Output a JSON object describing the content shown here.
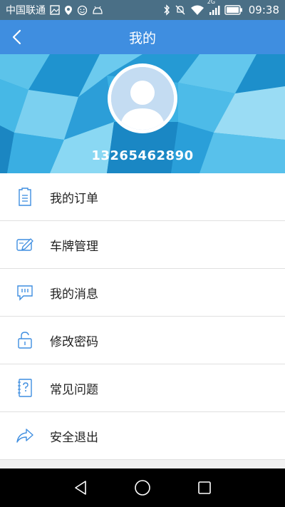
{
  "status_bar": {
    "carrier": "中国联通",
    "network": "2G",
    "time": "09:38"
  },
  "header": {
    "title": "我的"
  },
  "profile": {
    "phone": "13265462890"
  },
  "menu": {
    "items": [
      {
        "label": "我的订单",
        "icon": "order-list-icon"
      },
      {
        "label": "车牌管理",
        "icon": "license-plate-edit-icon"
      },
      {
        "label": "我的消息",
        "icon": "message-bubble-icon"
      },
      {
        "label": "修改密码",
        "icon": "unlock-icon"
      },
      {
        "label": "常见问题",
        "icon": "question-notebook-icon"
      },
      {
        "label": "安全退出",
        "icon": "share-arrow-icon"
      }
    ]
  },
  "colors": {
    "title_bar": "#3f8ee0",
    "status_bar": "#4a6f86",
    "icon_blue": "#3f8ee0",
    "banner": "#2aa6dc"
  }
}
